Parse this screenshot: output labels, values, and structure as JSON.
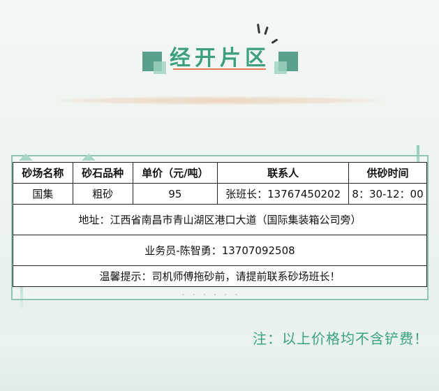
{
  "header": {
    "title": "经开片区"
  },
  "table": {
    "headers": [
      "砂场名称",
      "砂石品种",
      "单价（元/吨）",
      "联系人",
      "供砂时间"
    ],
    "row": [
      "国集",
      "粗砂",
      "95",
      "张班长：13767450202",
      "8：30-12：00"
    ],
    "address": "地址：江西省南昌市青山湖区港口大道（国际集装箱公司旁）",
    "salesperson": "业务员-陈智勇：13707092508",
    "reminder": "温馨提示：司机师傅拖砂前，请提前联系砂场班长！"
  },
  "note": "注：以上价格均不含铲费！",
  "colors": {
    "accent_green": "#3b9f80",
    "title_underline": "#e07a56",
    "frame": "#8fc4b4"
  }
}
